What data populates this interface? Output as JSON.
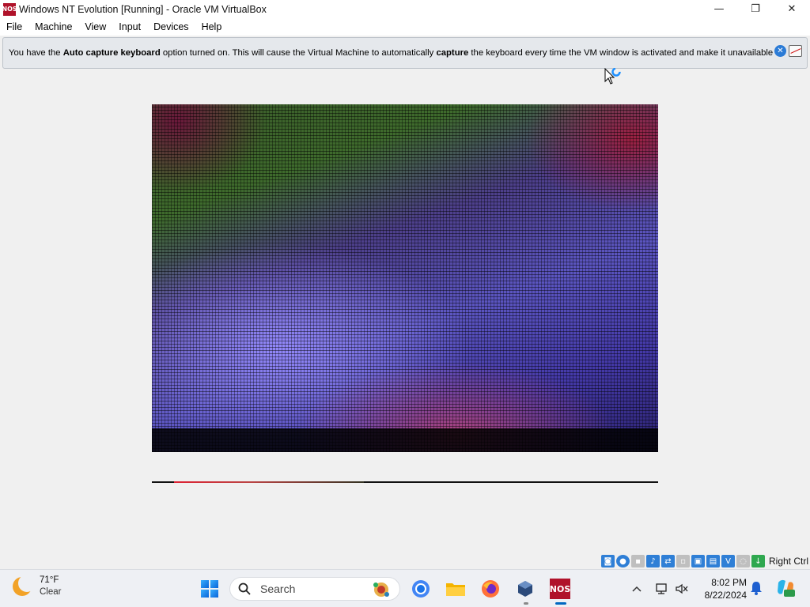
{
  "window": {
    "title": "Windows NT Evolution [Running] - Oracle VM VirtualBox",
    "icon_text": "NOS",
    "minimize_glyph": "—",
    "maximize_glyph": "❐",
    "close_glyph": "✕"
  },
  "menu": {
    "items": [
      "File",
      "Machine",
      "View",
      "Input",
      "Devices",
      "Help"
    ]
  },
  "notice": {
    "part1": "You have the ",
    "bold1": "Auto capture keyboard",
    "part2": " option turned on. This will cause the Virtual Machine to automatically ",
    "bold2": "capture",
    "part3": " the keyboard every time the VM window is activated and make it unavailable to",
    "close_glyph": "✕"
  },
  "statusbar": {
    "icons": [
      {
        "name": "hard-disk-icon",
        "color": "#2f7fd6"
      },
      {
        "name": "optical-drive-icon",
        "color": "#2f7fd6"
      },
      {
        "name": "floppy-icon",
        "color": "#bfbfbf"
      },
      {
        "name": "audio-icon",
        "color": "#2f7fd6"
      },
      {
        "name": "network-icon",
        "color": "#2f7fd6"
      },
      {
        "name": "usb-icon",
        "color": "#bfbfbf"
      },
      {
        "name": "shared-folders-icon",
        "color": "#2f7fd6"
      },
      {
        "name": "display-icon",
        "color": "#2f7fd6"
      },
      {
        "name": "recording-icon",
        "color": "#2f7fd6"
      },
      {
        "name": "cpu-icon",
        "color": "#bfbfbf"
      },
      {
        "name": "mouse-integration-icon",
        "color": "#2fa84f"
      }
    ],
    "host_key": "Right Ctrl"
  },
  "taskbar": {
    "weather": {
      "temp": "71°F",
      "condition": "Clear"
    },
    "search_label": "Search",
    "clock": {
      "time": "8:02 PM",
      "date": "8/22/2024"
    },
    "vm_app_label": "NOS",
    "tray_chevron": "^"
  }
}
